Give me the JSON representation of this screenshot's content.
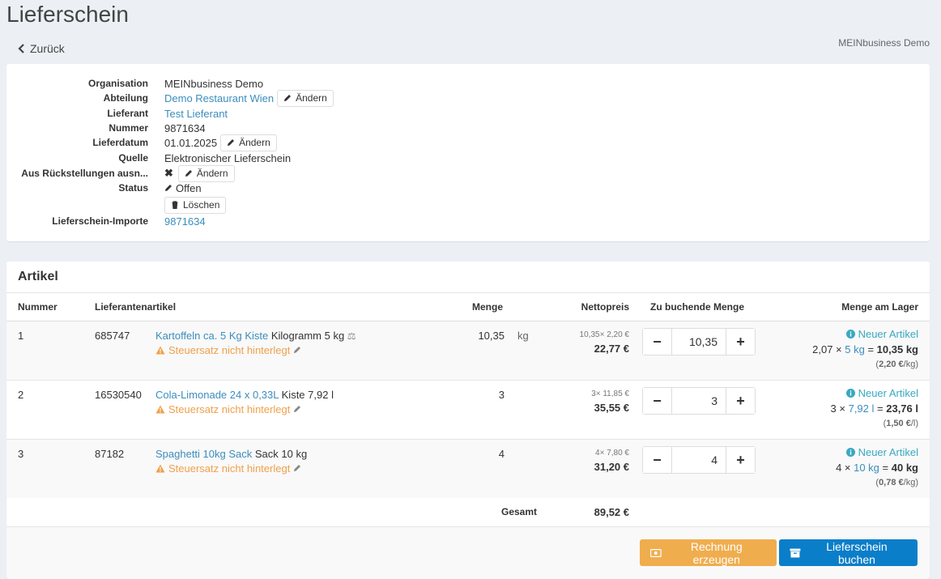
{
  "page": {
    "title": "Lieferschein",
    "back_label": "Zurück",
    "company": "MEINbusiness Demo"
  },
  "info": {
    "organisation_label": "Organisation",
    "organisation_value": "MEINbusiness Demo",
    "abteilung_label": "Abteilung",
    "abteilung_value": "Demo Restaurant Wien",
    "lieferant_label": "Lieferant",
    "lieferant_value": "Test Lieferant",
    "nummer_label": "Nummer",
    "nummer_value": "9871634",
    "lieferdatum_label": "Lieferdatum",
    "lieferdatum_value": "01.01.2025",
    "quelle_label": "Quelle",
    "quelle_value": "Elektronischer Lieferschein",
    "rueck_label": "Aus Rückstellungen ausn...",
    "status_label": "Status",
    "status_value": "Offen",
    "importe_label": "Lieferschein-Importe",
    "importe_value": "9871634",
    "change_label": "Ändern",
    "delete_label": "Löschen"
  },
  "articles": {
    "title": "Artikel",
    "headers": {
      "nummer": "Nummer",
      "lieferantenartikel": "Lieferantenartikel",
      "menge": "Menge",
      "nettopreis": "Nettopreis",
      "zu_buchende_menge": "Zu buchende Menge",
      "menge_am_lager": "Menge am Lager"
    },
    "warning_text": "Steuersatz nicht hinterlegt",
    "new_article_label": "Neuer Artikel",
    "rows": [
      {
        "num": "1",
        "supplier_no": "685747",
        "product_link": "Kartoffeln ca. 5 Kg Kiste",
        "product_desc": "Kilogramm 5 kg",
        "qty": "10,35",
        "unit": "kg",
        "price_calc": "10,35× 2,20 €",
        "price_total": "22,77 €",
        "book_qty": "10,35",
        "stock_pre": "2,07 × ",
        "stock_link": "5 kg",
        "stock_eq": " = ",
        "stock_total": "10,35 kg",
        "stock_unit_price": "2,20 €",
        "stock_unit_suffix": "/kg)"
      },
      {
        "num": "2",
        "supplier_no": "16530540",
        "product_link": "Cola-Limonade 24 x 0,33L",
        "product_desc": "Kiste 7,92 l",
        "qty": "3",
        "unit": "",
        "price_calc": "3× 11,85 €",
        "price_total": "35,55 €",
        "book_qty": "3",
        "stock_pre": "3 × ",
        "stock_link": "7,92 l",
        "stock_eq": " = ",
        "stock_total": "23,76 l",
        "stock_unit_price": "1,50 €",
        "stock_unit_suffix": "/l)"
      },
      {
        "num": "3",
        "supplier_no": "87182",
        "product_link": "Spaghetti 10kg Sack",
        "product_desc": "Sack 10 kg",
        "qty": "4",
        "unit": "",
        "price_calc": "4× 7,80 €",
        "price_total": "31,20 €",
        "book_qty": "4",
        "stock_pre": "4 × ",
        "stock_link": "10 kg",
        "stock_eq": " = ",
        "stock_total": "40 kg",
        "stock_unit_price": "0,78 €",
        "stock_unit_suffix": "/kg)"
      }
    ],
    "total_label": "Gesamt",
    "total_value": "89,52 €"
  },
  "actions": {
    "invoice_label": "Rechnung erzeugen",
    "book_label": "Lieferschein buchen"
  },
  "colors": {
    "link": "#3c8dbc",
    "warning": "#f0a04b",
    "info": "#3aa8c1",
    "orange_button": "#f0ad4e",
    "blue_button": "#0b7ec9"
  }
}
